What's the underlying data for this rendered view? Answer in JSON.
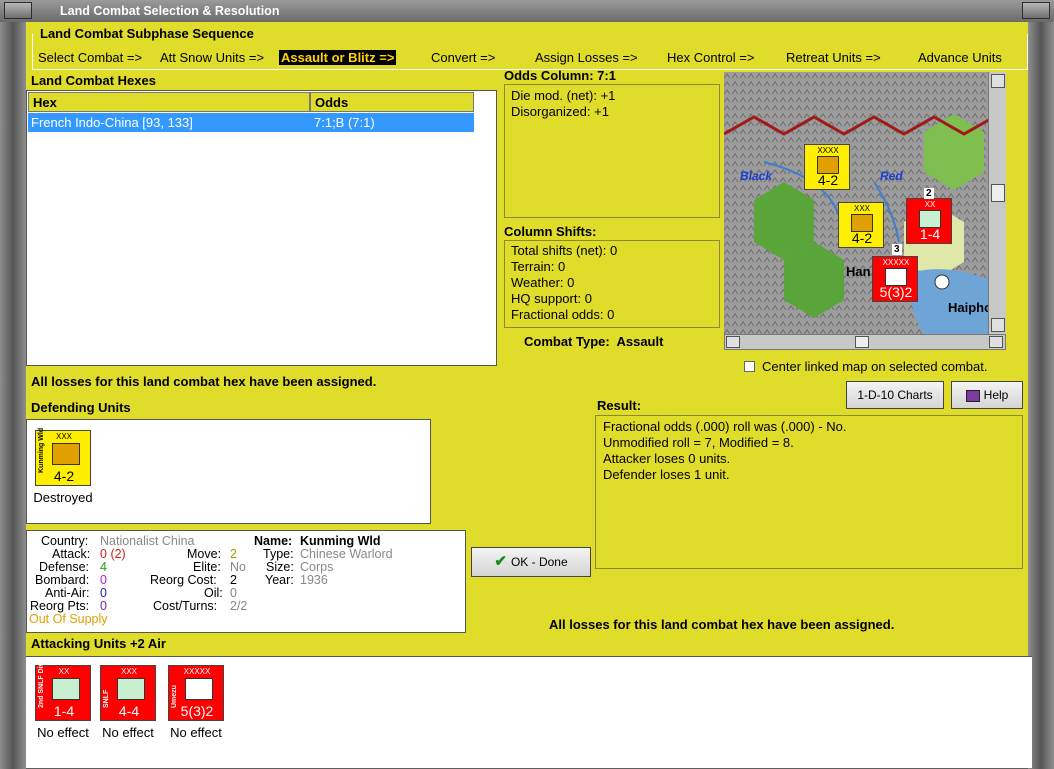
{
  "window": {
    "title": "Land Combat Selection & Resolution"
  },
  "subphase": {
    "title": "Land Combat Subphase Sequence",
    "steps": [
      "Select Combat =>",
      "Att Snow Units =>",
      "Assault or Blitz =>",
      "Convert =>",
      "Assign Losses =>",
      "Hex Control =>",
      "Retreat Units =>",
      "Advance Units"
    ],
    "active_step": "Assault or Blitz =>"
  },
  "hexes": {
    "title": "Land Combat Hexes",
    "headers": [
      "Hex",
      "Odds"
    ],
    "rows": [
      {
        "hex": "French Indo-China [93, 133]",
        "odds": "7:1;B (7:1)"
      }
    ]
  },
  "odds_column": {
    "title": "Odds Column: 7:1",
    "lines": [
      "Die mod. (net): +1",
      "Disorganized: +1"
    ]
  },
  "column_shifts": {
    "title": "Column Shifts:",
    "lines": [
      "Total shifts (net): 0",
      "Terrain: 0",
      "Weather: 0",
      "HQ support: 0",
      "Fractional odds: 0"
    ]
  },
  "combat_type": {
    "label": "Combat Type:",
    "value": "Assault"
  },
  "map": {
    "center_linked_label": "Center linked map on selected combat.",
    "labels": {
      "black": "Black",
      "red": "Red",
      "hanoi": "Han",
      "haiphong": "Haipho"
    },
    "map_counters": [
      {
        "size": "XXXX",
        "value": "4-2",
        "color": "yellow",
        "side": "Coastline"
      },
      {
        "size": "XXX",
        "value": "4-2",
        "color": "yellow",
        "side": "Kunming Wld"
      },
      {
        "size": "XX",
        "value": "1-4",
        "color": "red",
        "side": "2nd SNLF"
      },
      {
        "size": "XXXXX",
        "value": "5(3)2",
        "color": "red",
        "side": "Umezu"
      }
    ],
    "stack_counts": [
      "2",
      "3"
    ]
  },
  "losses_msg": "All losses for this land combat hex have been assigned.",
  "defending": {
    "title": "Defending Units",
    "units": [
      {
        "size": "XXX",
        "side": "Kunming Wld",
        "value": "4-2",
        "status": "Destroyed",
        "color": "#ffee00"
      }
    ]
  },
  "result": {
    "title": "Result:",
    "lines": [
      "Fractional odds (.000) roll was (.000)  - No.",
      "Unmodified roll = 7, Modified = 8.",
      "Attacker loses 0 units.",
      "Defender loses 1 unit."
    ]
  },
  "buttons": {
    "charts": "1-D-10 Charts",
    "help": "Help",
    "ok": "OK - Done"
  },
  "unit_info": {
    "country_label": "Country:",
    "country": "Nationalist China",
    "attack_label": "Attack:",
    "attack": "0",
    "attack_paren": "(2)",
    "defense_label": "Defense:",
    "defense": "4",
    "bombard_label": "Bombard:",
    "bombard": "0",
    "antiair_label": "Anti-Air:",
    "antiair": "0",
    "reorg_label": "Reorg Pts:",
    "reorg": "0",
    "supply": "Out Of Supply",
    "move_label": "Move:",
    "move": "2",
    "elite_label": "Elite:",
    "elite": "No",
    "reorg_cost_label": "Reorg Cost:",
    "reorg_cost": "2",
    "oil_label": "Oil:",
    "oil": "0",
    "cost_label": "Cost/Turns:",
    "cost": "2/2",
    "name_label": "Name:",
    "name": "Kunming Wld",
    "type_label": "Type:",
    "type": "Chinese Warlord",
    "size_label": "Size:",
    "size": "Corps",
    "year_label": "Year:",
    "year": "1936"
  },
  "attacking": {
    "title": "Attacking Units +2 Air",
    "units": [
      {
        "size": "XX",
        "side": "2nd SNLF Div",
        "value": "1-4",
        "status": "No effect"
      },
      {
        "size": "XXX",
        "side": "SNLF",
        "value": "4-4",
        "status": "No effect"
      },
      {
        "size": "XXXXX",
        "side": "Umezu",
        "value": "5(3)2",
        "status": "No effect"
      }
    ]
  },
  "colors": {
    "panel": "#e0dc2a",
    "selection": "#3399ff",
    "attacker": "#ff0000",
    "defender": "#ffee00"
  }
}
